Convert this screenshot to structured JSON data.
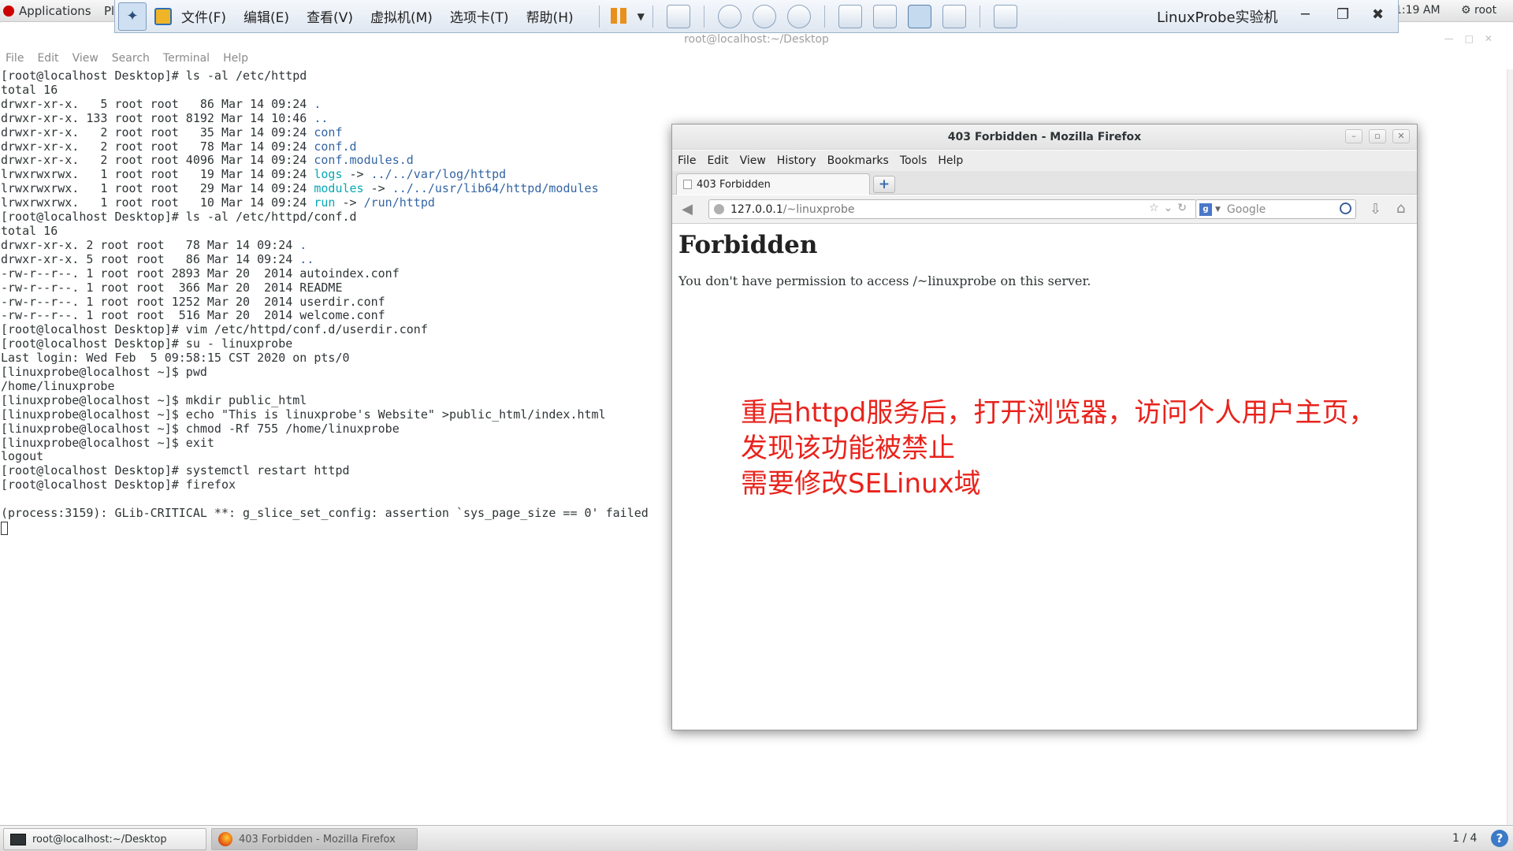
{
  "gnome_panel": {
    "applications_label": "Applications",
    "places_label": "Pl",
    "clock": "1:19 AM",
    "user": "root"
  },
  "vm_toolbar": {
    "menu": [
      "文件(F)",
      "编辑(E)",
      "查看(V)",
      "虚拟机(M)",
      "选项卡(T)",
      "帮助(H)"
    ],
    "title": "LinuxProbe实验机",
    "icons": [
      "pin-icon",
      "vmware-logo-icon",
      "pause-icon",
      "dropdown-arrow-icon",
      "send-keys-icon",
      "snapshot-take-icon",
      "snapshot-revert-icon",
      "snapshot-manager-icon",
      "library-view-icon",
      "console-view-icon",
      "fullscreen-icon",
      "unity-icon",
      "thumbnail-view-icon"
    ]
  },
  "terminal": {
    "title": "root@localhost:~/Desktop",
    "menu": [
      "File",
      "Edit",
      "View",
      "Search",
      "Terminal",
      "Help"
    ],
    "lines": [
      [
        {
          "t": "[root@localhost Desktop]# ls -al /etc/httpd"
        }
      ],
      [
        {
          "t": "total 16"
        }
      ],
      [
        {
          "t": "drwxr-xr-x.   5 root root   86 Mar 14 09:24 "
        },
        {
          "t": ".",
          "c": "dir"
        }
      ],
      [
        {
          "t": "drwxr-xr-x. 133 root root 8192 Mar 14 10:46 "
        },
        {
          "t": "..",
          "c": "dir"
        }
      ],
      [
        {
          "t": "drwxr-xr-x.   2 root root   35 Mar 14 09:24 "
        },
        {
          "t": "conf",
          "c": "dir"
        }
      ],
      [
        {
          "t": "drwxr-xr-x.   2 root root   78 Mar 14 09:24 "
        },
        {
          "t": "conf.d",
          "c": "dir"
        }
      ],
      [
        {
          "t": "drwxr-xr-x.   2 root root 4096 Mar 14 09:24 "
        },
        {
          "t": "conf.modules.d",
          "c": "dir"
        }
      ],
      [
        {
          "t": "lrwxrwxrwx.   1 root root   19 Mar 14 09:24 "
        },
        {
          "t": "logs",
          "c": "link"
        },
        {
          "t": " -> "
        },
        {
          "t": "../../var/log/httpd",
          "c": "dir"
        }
      ],
      [
        {
          "t": "lrwxrwxrwx.   1 root root   29 Mar 14 09:24 "
        },
        {
          "t": "modules",
          "c": "link"
        },
        {
          "t": " -> "
        },
        {
          "t": "../../usr/lib64/httpd/modules",
          "c": "dir"
        }
      ],
      [
        {
          "t": "lrwxrwxrwx.   1 root root   10 Mar 14 09:24 "
        },
        {
          "t": "run",
          "c": "link"
        },
        {
          "t": " -> "
        },
        {
          "t": "/run/httpd",
          "c": "dir"
        }
      ],
      [
        {
          "t": "[root@localhost Desktop]# ls -al /etc/httpd/conf.d"
        }
      ],
      [
        {
          "t": "total 16"
        }
      ],
      [
        {
          "t": "drwxr-xr-x. 2 root root   78 Mar 14 09:24 "
        },
        {
          "t": ".",
          "c": "dir"
        }
      ],
      [
        {
          "t": "drwxr-xr-x. 5 root root   86 Mar 14 09:24 "
        },
        {
          "t": "..",
          "c": "dir"
        }
      ],
      [
        {
          "t": "-rw-r--r--. 1 root root 2893 Mar 20  2014 autoindex.conf"
        }
      ],
      [
        {
          "t": "-rw-r--r--. 1 root root  366 Mar 20  2014 README"
        }
      ],
      [
        {
          "t": "-rw-r--r--. 1 root root 1252 Mar 20  2014 userdir.conf"
        }
      ],
      [
        {
          "t": "-rw-r--r--. 1 root root  516 Mar 20  2014 welcome.conf"
        }
      ],
      [
        {
          "t": "[root@localhost Desktop]# vim /etc/httpd/conf.d/userdir.conf"
        }
      ],
      [
        {
          "t": "[root@localhost Desktop]# su - linuxprobe"
        }
      ],
      [
        {
          "t": "Last login: Wed Feb  5 09:58:15 CST 2020 on pts/0"
        }
      ],
      [
        {
          "t": "[linuxprobe@localhost ~]$ pwd"
        }
      ],
      [
        {
          "t": "/home/linuxprobe"
        }
      ],
      [
        {
          "t": "[linuxprobe@localhost ~]$ mkdir public_html"
        }
      ],
      [
        {
          "t": "[linuxprobe@localhost ~]$ echo \"This is linuxprobe's Website\" >public_html/index.html"
        }
      ],
      [
        {
          "t": "[linuxprobe@localhost ~]$ chmod -Rf 755 /home/linuxprobe"
        }
      ],
      [
        {
          "t": "[linuxprobe@localhost ~]$ exit"
        }
      ],
      [
        {
          "t": "logout"
        }
      ],
      [
        {
          "t": "[root@localhost Desktop]# systemctl restart httpd"
        }
      ],
      [
        {
          "t": "[root@localhost Desktop]# firefox"
        }
      ],
      [
        {
          "t": ""
        }
      ],
      [
        {
          "t": "(process:3159): GLib-CRITICAL **: g_slice_set_config: assertion `sys_page_size == 0' failed"
        }
      ]
    ]
  },
  "firefox": {
    "title": "403 Forbidden - Mozilla Firefox",
    "menu": [
      "File",
      "Edit",
      "View",
      "History",
      "Bookmarks",
      "Tools",
      "Help"
    ],
    "tab_label": "403 Forbidden",
    "new_tab_glyph": "+",
    "url_domain": "127.0.0.1",
    "url_path": "/~linuxprobe",
    "search_placeholder": "Google",
    "page_heading": "Forbidden",
    "page_message": "You don't have permission to access /~linuxprobe on this server."
  },
  "annotation": {
    "lines": [
      "重启httpd服务后，打开浏览器，访问个人用户主页，",
      "发现该功能被禁止",
      "需要修改SELinux域"
    ],
    "color": "#e8231c"
  },
  "taskbar": {
    "items": [
      {
        "label": "root@localhost:~/Desktop"
      },
      {
        "label": "403 Forbidden - Mozilla Firefox"
      }
    ],
    "pager": "1 / 4"
  }
}
